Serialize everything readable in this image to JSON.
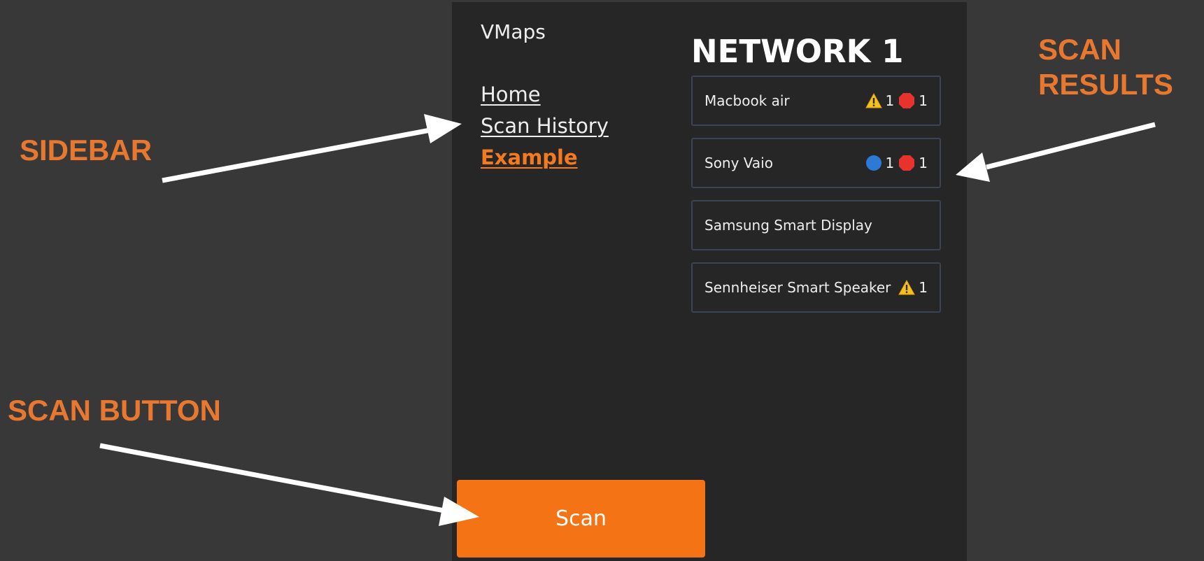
{
  "app": {
    "title": "VMaps"
  },
  "sidebar": {
    "items": [
      {
        "label": "Home",
        "active": false
      },
      {
        "label": "Scan History",
        "active": false
      },
      {
        "label": "Example",
        "active": true
      }
    ]
  },
  "scan_button": {
    "label": "Scan"
  },
  "results": {
    "title": "NETWORK 1",
    "devices": [
      {
        "name": "Macbook air",
        "badges": [
          {
            "icon": "warning-icon",
            "count": "1"
          },
          {
            "icon": "stop-icon",
            "count": "1"
          }
        ]
      },
      {
        "name": "Sony Vaio",
        "badges": [
          {
            "icon": "info-icon",
            "count": "1"
          },
          {
            "icon": "stop-icon",
            "count": "1"
          }
        ]
      },
      {
        "name": "Samsung Smart Display",
        "badges": []
      },
      {
        "name": "Sennheiser Smart Speaker",
        "badges": [
          {
            "icon": "warning-icon",
            "count": "1"
          }
        ]
      }
    ]
  },
  "annotations": {
    "sidebar": "SIDEBAR",
    "scan_results_line1": "SCAN",
    "scan_results_line2": "RESULTS",
    "scan_button": "SCAN BUTTON"
  },
  "colors": {
    "background": "#383838",
    "app_background": "#262626",
    "accent": "#f47315",
    "callout": "#e8782f",
    "card_border": "#3b4452"
  }
}
